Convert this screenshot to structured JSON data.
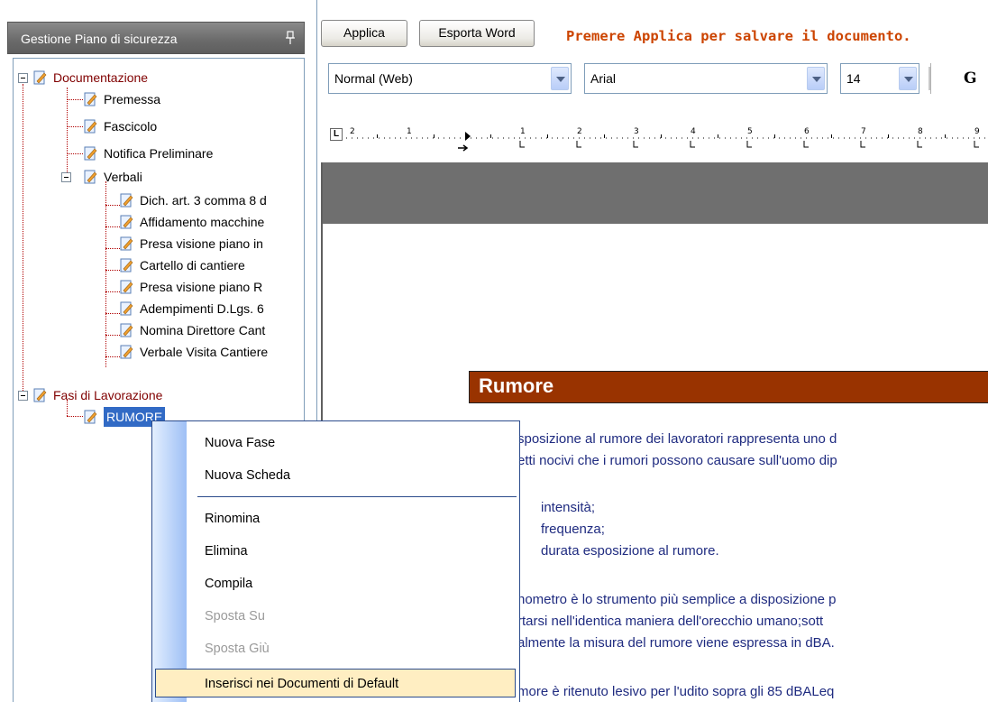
{
  "panel": {
    "title": "Gestione Piano di sicurezza",
    "pin_icon": "pin-icon"
  },
  "tree": {
    "documentazione": "Documentazione",
    "premessa": "Premessa",
    "fascicolo": "Fascicolo",
    "notifica": "Notifica Preliminare",
    "verbali": "Verbali",
    "verbali_items": [
      "Dich. art. 3 comma 8 d",
      "Affidamento macchine",
      "Presa visione piano in",
      "Cartello di cantiere",
      "Presa visione piano R",
      "Adempimenti D.Lgs. 6",
      "Nomina Direttore Cant",
      "Verbale Visita Cantiere"
    ],
    "fasi": "Fasi di Lavorazione",
    "rumore": "RUMORE"
  },
  "toolbar": {
    "apply_label": "Applica",
    "export_label": "Esporta Word",
    "hint": "Premere Applica per salvare il documento.",
    "style_value": "Normal (Web)",
    "font_value": "Arial",
    "size_value": "14",
    "bold_label": "G"
  },
  "document": {
    "section_title": "Rumore",
    "lines": [
      "sposizione al rumore dei lavoratori rappresenta uno d",
      "etti nocivi che i rumori possono causare sull'uomo dip",
      "intensità;",
      "frequenza;",
      "durata esposizione al rumore.",
      "nometro è lo strumento più  semplice a disposizione p",
      "rtarsi nell'identica maniera dell'orecchio umano;sott",
      "almente la misura del rumore viene espressa in dBA.",
      "more è ritenuto lesivo per l'udito sopra gli 85 dBALeq"
    ]
  },
  "context_menu": {
    "items": [
      "Nuova Fase",
      "Nuova Scheda",
      "Rinomina",
      "Elimina",
      "Compila",
      "Sposta Su",
      "Sposta Giù",
      "Inserisci nei Documenti di Default"
    ]
  },
  "colors": {
    "tree_parent": "#800000",
    "hint": "#cc4400",
    "section_band": "#993300",
    "doc_text": "#1f2b80",
    "selection": "#316ac5",
    "menu_highlight": "#ffeec2"
  }
}
